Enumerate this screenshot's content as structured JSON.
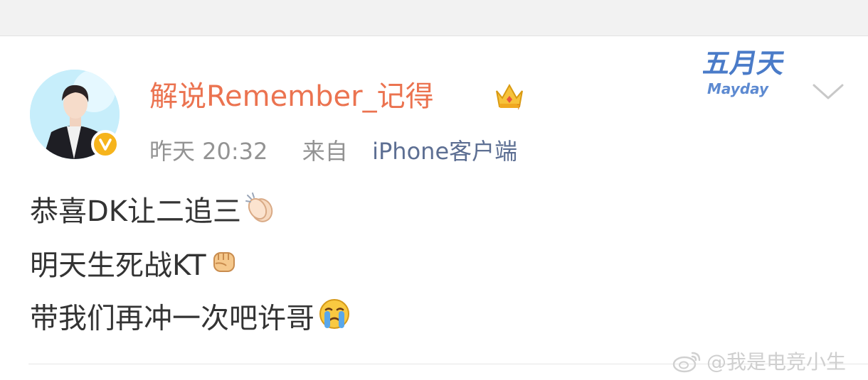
{
  "post": {
    "author": "解说Remember_记得",
    "timestamp": "昨天 20:32",
    "source_prefix": "来自",
    "source": "iPhone客户端",
    "lines": [
      "恭喜DK让二追三",
      "明天生死战KT",
      "带我们再冲一次吧许哥"
    ],
    "line_emojis": [
      "clap-emoji",
      "fist-emoji",
      "crying-emoji"
    ]
  },
  "badges": {
    "vip_crown": "crown-icon",
    "verified": "verified-v-icon",
    "mayday_badge_text": "五月天",
    "mayday_badge_subtext": "Mayday"
  },
  "menu": {
    "chevron": "chevron-down-icon"
  },
  "watermark": {
    "text": "@我是电竞小生",
    "icon": "weibo-logo-icon"
  },
  "colors": {
    "author": "#eb7350",
    "meta": "#939393",
    "source": "#5d6f93",
    "body_text": "#333333"
  }
}
